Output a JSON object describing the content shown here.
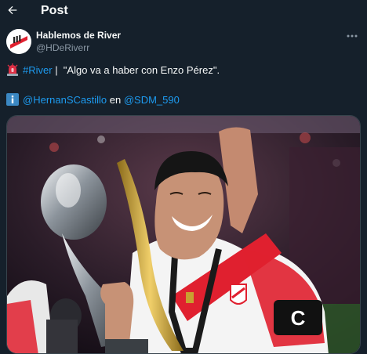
{
  "header": {
    "title": "Post"
  },
  "author": {
    "display_name": "Hablemos de River",
    "handle": "@HDeRiverr"
  },
  "tweet": {
    "line1": {
      "hashtag": "#River",
      "separator": " |  ",
      "quote": "\"Algo va a haber con Enzo Pérez\"."
    },
    "line2": {
      "mention1": "@HernanSCastillo",
      "connector": " en ",
      "mention2": "@SDM_590"
    }
  },
  "jersey": {
    "captain_band": "C"
  },
  "icons": {
    "back": "arrow-left-icon",
    "more": "more-horizontal-icon",
    "siren": "police-light-emoji",
    "info": "information-emoji"
  },
  "colors": {
    "background": "#15202b",
    "link": "#1d9bf0",
    "secondary_text": "#8b98a5",
    "river_red": "#e0202f"
  }
}
